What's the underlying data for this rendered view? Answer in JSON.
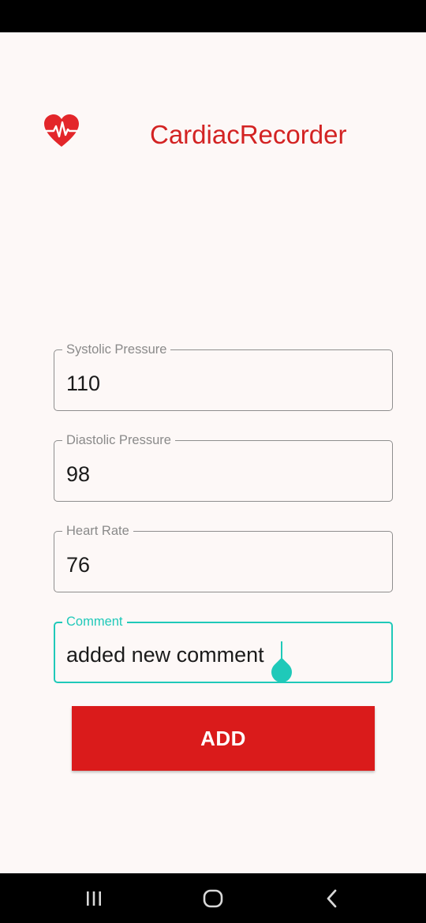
{
  "app": {
    "title": "CardiacRecorder",
    "logo_icon": "heart-pulse-icon",
    "brand_color": "#d32323"
  },
  "form": {
    "fields": [
      {
        "label": "Systolic Pressure",
        "value": "110"
      },
      {
        "label": "Diastolic Pressure",
        "value": "98"
      },
      {
        "label": "Heart Rate",
        "value": "76"
      },
      {
        "label": "Comment",
        "value": "added new comment",
        "focused": true
      }
    ],
    "focus_color": "#1fc9b9",
    "add_button_label": "ADD",
    "add_button_color": "#da1b1b"
  },
  "nav_bar": {
    "buttons": [
      "recent-apps-icon",
      "home-icon",
      "back-icon"
    ]
  }
}
